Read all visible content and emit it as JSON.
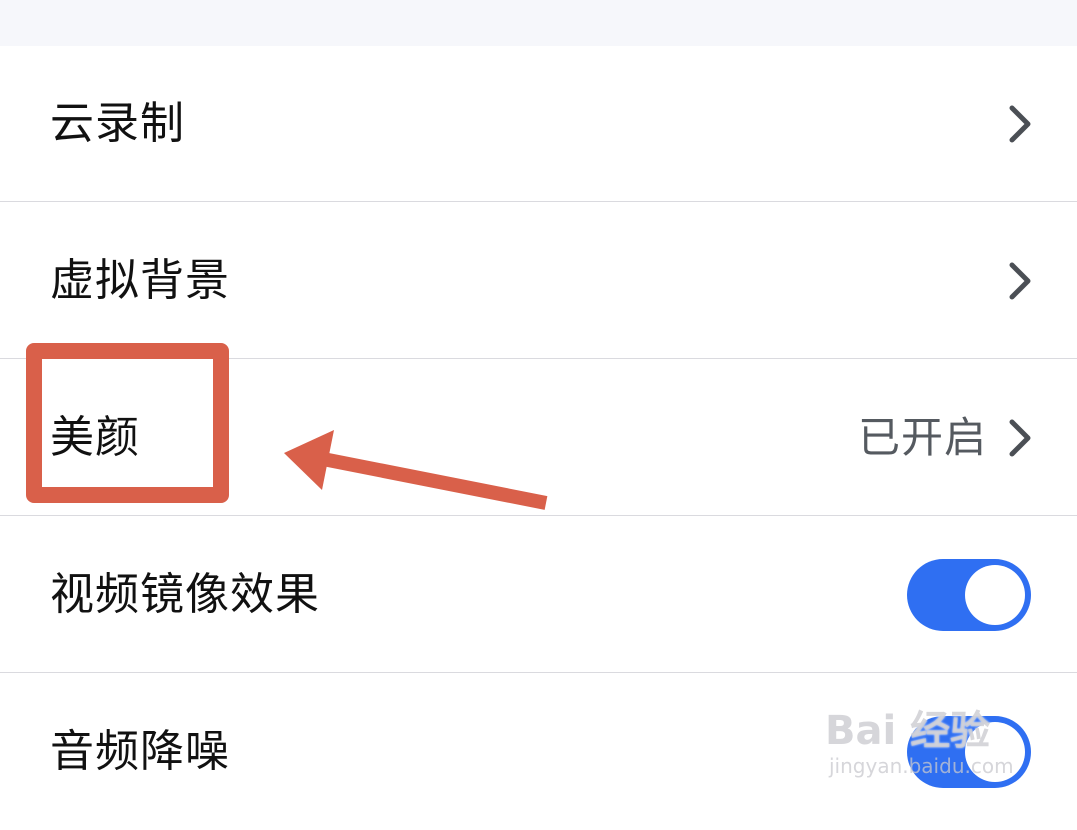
{
  "settings": {
    "items": [
      {
        "label": "云录制",
        "control": "chevron"
      },
      {
        "label": "虚拟背景",
        "control": "chevron"
      },
      {
        "label": "美颜",
        "value": "已开启",
        "control": "chevron"
      },
      {
        "label": "视频镜像效果",
        "control": "toggle",
        "on": true
      },
      {
        "label": "音频降噪",
        "control": "toggle",
        "on": true
      }
    ]
  },
  "annotation": {
    "highlight_target": "美颜",
    "color": "#d9604a"
  },
  "watermark": {
    "main": "Bai 经验",
    "sub": "jingyan.baidu.com"
  },
  "colors": {
    "toggle_on": "#2f6ff2",
    "divider": "#dadadf",
    "top_band": "#f6f7fb"
  }
}
